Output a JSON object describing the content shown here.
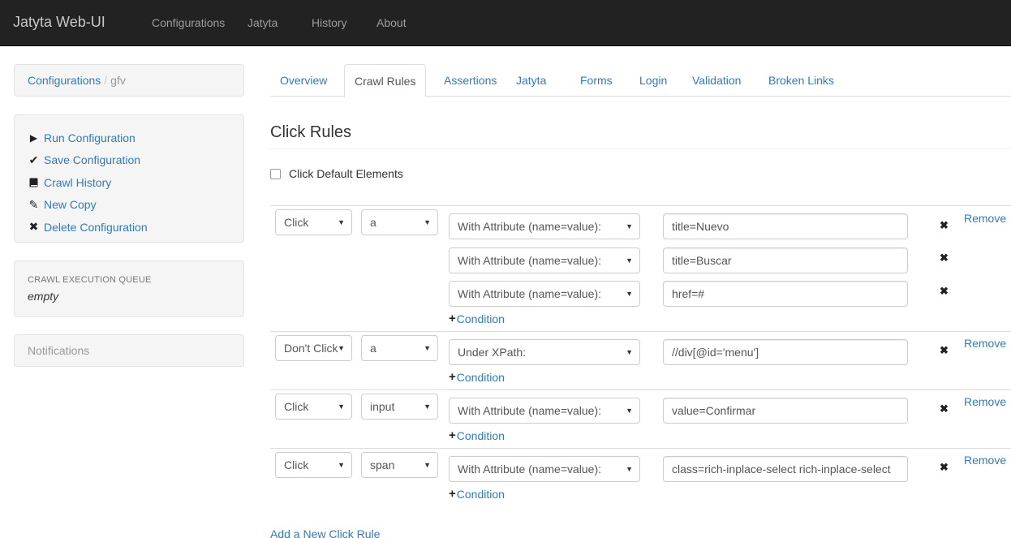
{
  "navbar": {
    "brand": "Jatyta Web-UI",
    "links": [
      "Configurations",
      "Jatyta",
      "History",
      "About"
    ]
  },
  "breadcrumb": {
    "parent": "Configurations",
    "separator": "/",
    "current": "gfv"
  },
  "actions": [
    {
      "label": "Run Configuration",
      "icon": "play-icon"
    },
    {
      "label": "Save Configuration",
      "icon": "check-icon"
    },
    {
      "label": "Crawl History",
      "icon": "book-icon"
    },
    {
      "label": "New Copy",
      "icon": "pencil-icon"
    },
    {
      "label": "Delete Configuration",
      "icon": "remove-icon"
    }
  ],
  "queue": {
    "title": "CRAWL EXECUTION QUEUE",
    "value": "empty"
  },
  "notifications": {
    "label": "Notifications"
  },
  "tabs": [
    {
      "label": "Overview",
      "active": false
    },
    {
      "label": "Crawl Rules",
      "active": true
    },
    {
      "label": "Assertions",
      "active": false
    },
    {
      "label": "Jatyta",
      "active": false
    },
    {
      "label": "Forms",
      "active": false
    },
    {
      "label": "Login",
      "active": false
    },
    {
      "label": "Validation",
      "active": false
    },
    {
      "label": "Broken Links",
      "active": false
    }
  ],
  "section": {
    "title": "Click Rules",
    "default_elements_label": "Click Default Elements",
    "default_elements_checked": false
  },
  "rules": [
    {
      "action": "Click",
      "tag": "a",
      "remove_label": "Remove",
      "conditions": [
        {
          "type": "With Attribute (name=value):",
          "value": "title=Nuevo"
        },
        {
          "type": "With Attribute (name=value):",
          "value": "title=Buscar"
        },
        {
          "type": "With Attribute (name=value):",
          "value": "href=#"
        }
      ],
      "add_condition_label": "Condition"
    },
    {
      "action": "Don't Click",
      "tag": "a",
      "remove_label": "Remove",
      "conditions": [
        {
          "type": "Under XPath:",
          "value": "//div[@id='menu']"
        }
      ],
      "add_condition_label": "Condition"
    },
    {
      "action": "Click",
      "tag": "input",
      "remove_label": "Remove",
      "conditions": [
        {
          "type": "With Attribute (name=value):",
          "value": "value=Confirmar"
        }
      ],
      "add_condition_label": "Condition"
    },
    {
      "action": "Click",
      "tag": "span",
      "remove_label": "Remove",
      "conditions": [
        {
          "type": "With Attribute (name=value):",
          "value": "class=rich-inplace-select rich-inplace-select"
        }
      ],
      "add_condition_label": "Condition"
    }
  ],
  "add_rule_label": "Add a New Click Rule",
  "colors": {
    "navbar_bg": "#222222",
    "link": "#337ab7",
    "well_bg": "#f5f5f5"
  }
}
